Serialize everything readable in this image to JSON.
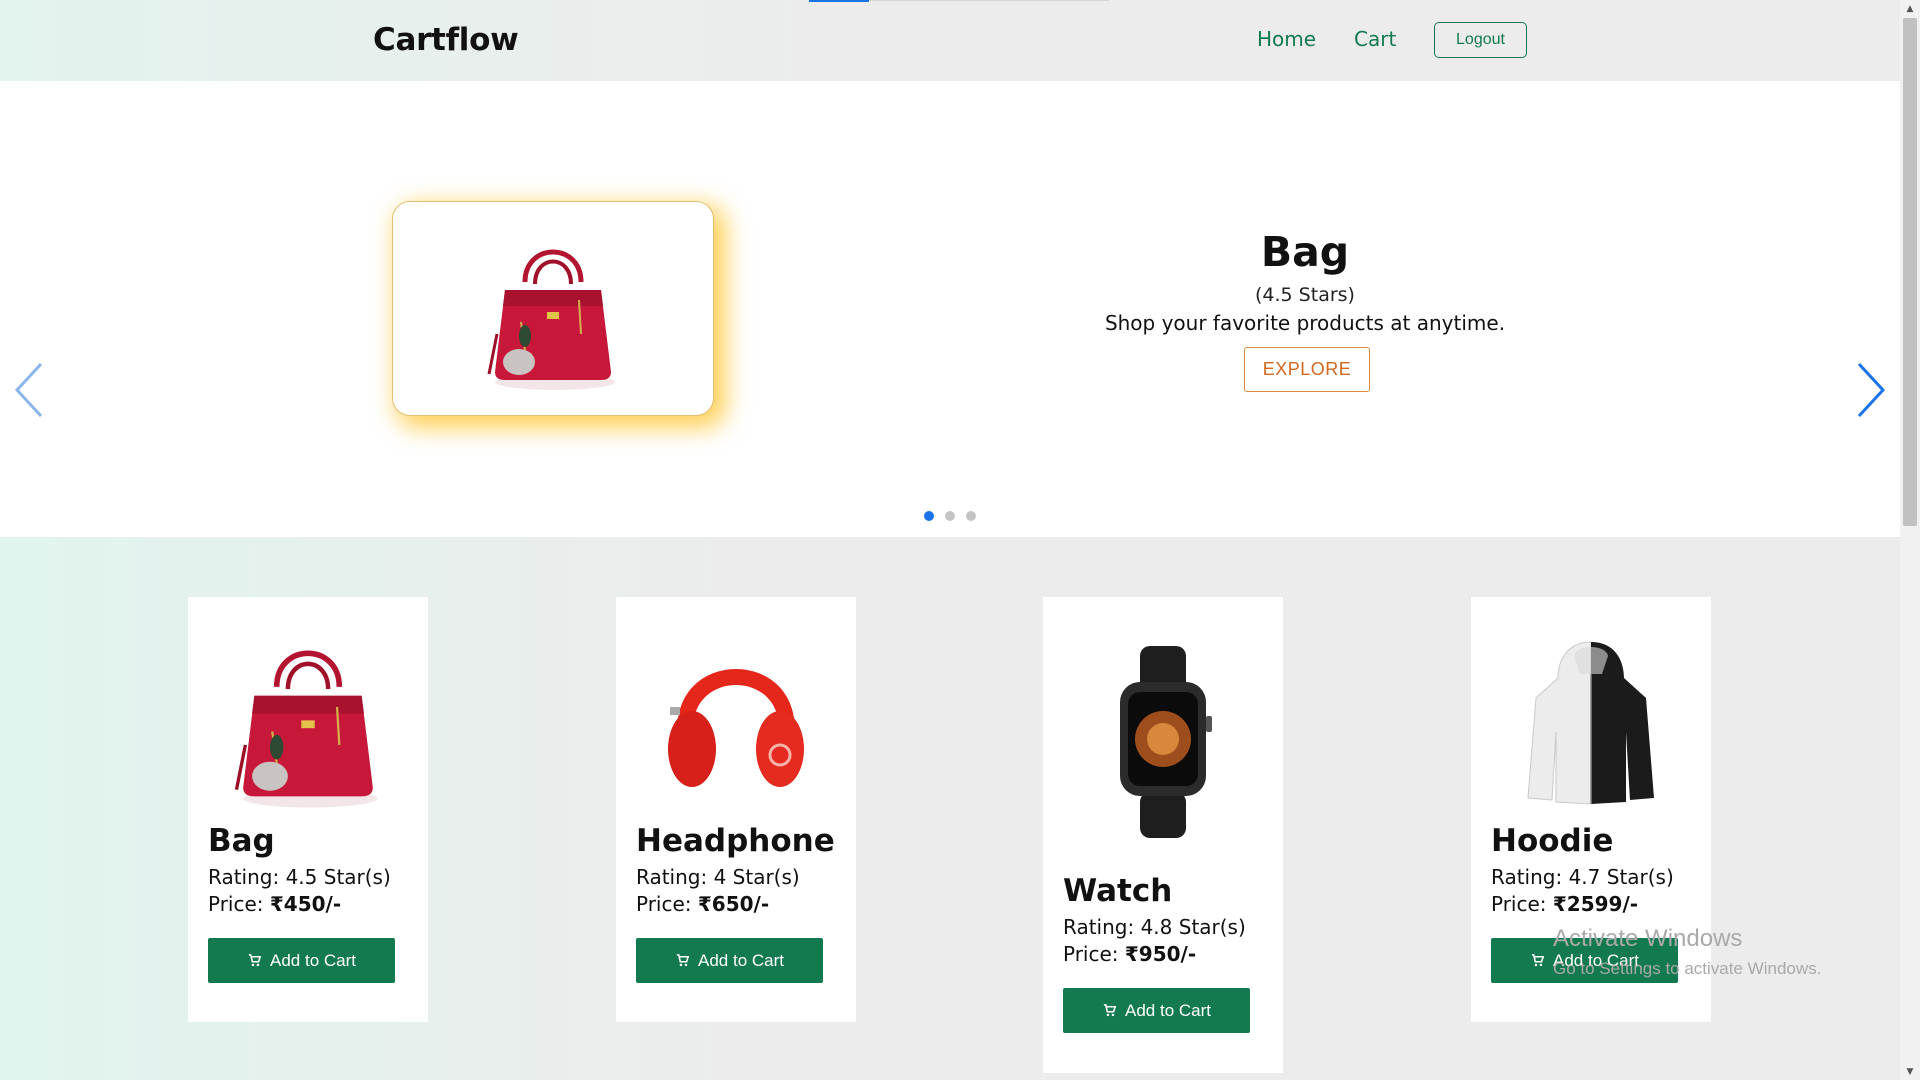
{
  "header": {
    "brand": "Cartflow",
    "nav": {
      "home": "Home",
      "cart": "Cart"
    },
    "logout_label": "Logout"
  },
  "hero": {
    "title": "Bag",
    "rating": "(4.5 Stars)",
    "tagline": "Shop your favorite products at anytime.",
    "cta_label": "EXPLORE",
    "slide_count": 3,
    "active_slide": 1,
    "image": "handbag-image"
  },
  "products": [
    {
      "name": "Bag",
      "rating": "Rating: 4.5 Star(s)",
      "price_label": "Price:",
      "price": "₹450/-",
      "button": "Add to Cart",
      "image": "handbag-image"
    },
    {
      "name": "Headphone",
      "rating": "Rating: 4 Star(s)",
      "price_label": "Price:",
      "price": "₹650/-",
      "button": "Add to Cart",
      "image": "headphone-image"
    },
    {
      "name": "Watch",
      "rating": "Rating: 4.8 Star(s)",
      "price_label": "Price:",
      "price": "₹950/-",
      "button": "Add to Cart",
      "image": "watch-image"
    },
    {
      "name": "Hoodie",
      "rating": "Rating: 4.7 Star(s)",
      "price_label": "Price:",
      "price": "₹2599/-",
      "button": "Add to Cart",
      "image": "hoodie-image"
    }
  ],
  "watermark": {
    "line1": "Activate Windows",
    "line2": "Go to Settings to activate Windows."
  },
  "colors": {
    "brand_green": "#137a4f",
    "accent_blue": "#1a73e8",
    "explore_orange": "#d2691e",
    "glow": "#ffb800"
  }
}
